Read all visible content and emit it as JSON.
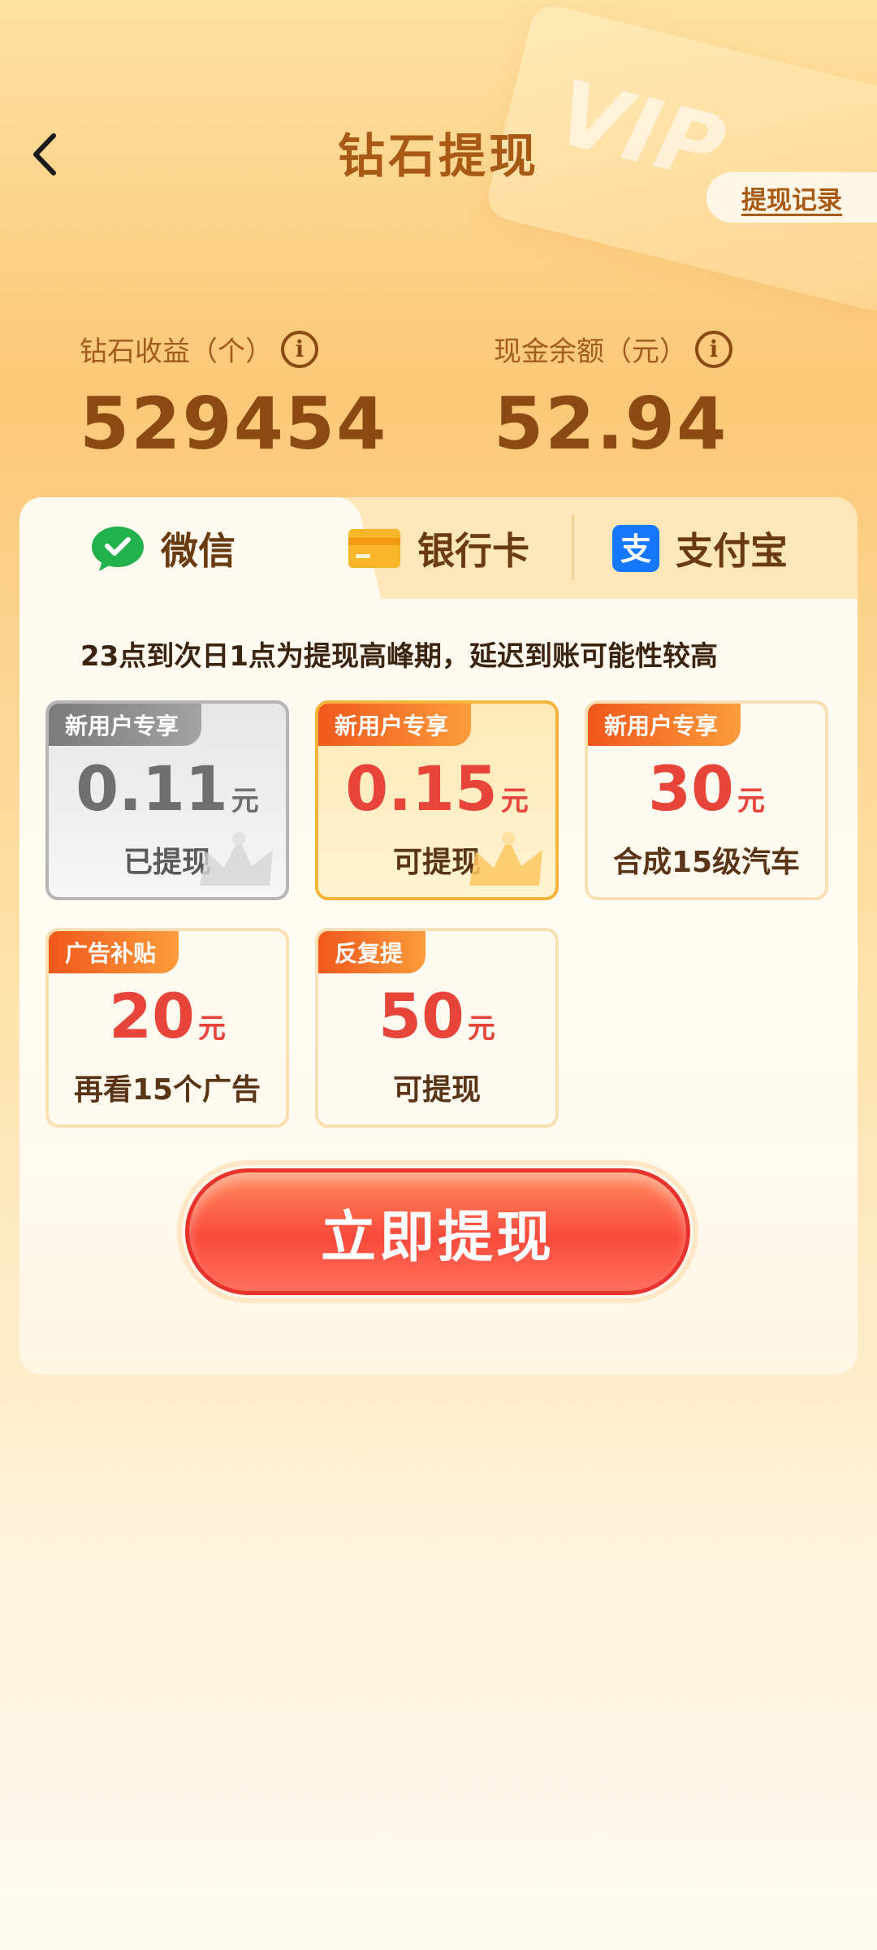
{
  "header": {
    "title": "钻石提现",
    "record_label": "提现记录",
    "vip_deco_text": "VIP"
  },
  "stats": {
    "diamond_label": "钻石收益（个）",
    "diamond_value": "529454",
    "cash_label": "现金余额（元）",
    "cash_value": "52.94"
  },
  "tabs": [
    {
      "label": "微信",
      "icon": "wechat-icon",
      "active": true
    },
    {
      "label": "银行卡",
      "icon": "bank-card-icon",
      "active": false
    },
    {
      "label": "支付宝",
      "icon": "alipay-icon",
      "active": false
    }
  ],
  "notice": "23点到次日1点为提现高峰期，延迟到账可能性较高",
  "options": [
    {
      "badge": "新用户专享",
      "amount": "0.11",
      "unit": "元",
      "sub": "已提现",
      "state": "used"
    },
    {
      "badge": "新用户专享",
      "amount": "0.15",
      "unit": "元",
      "sub": "可提现",
      "state": "selected"
    },
    {
      "badge": "新用户专享",
      "amount": "30",
      "unit": "元",
      "sub": "合成15级汽车",
      "state": "normal"
    },
    {
      "badge": "广告补贴",
      "amount": "20",
      "unit": "元",
      "sub": "再看15个广告",
      "state": "normal"
    },
    {
      "badge": "反复提",
      "amount": "50",
      "unit": "元",
      "sub": "可提现",
      "state": "normal"
    }
  ],
  "action": {
    "label": "立即提现"
  },
  "colors": {
    "accent_red": "#e8453a",
    "brown": "#8a4a12",
    "badge_orange": "#f0581c",
    "wechat_green": "#22b14c",
    "alipay_blue": "#1677ff"
  }
}
